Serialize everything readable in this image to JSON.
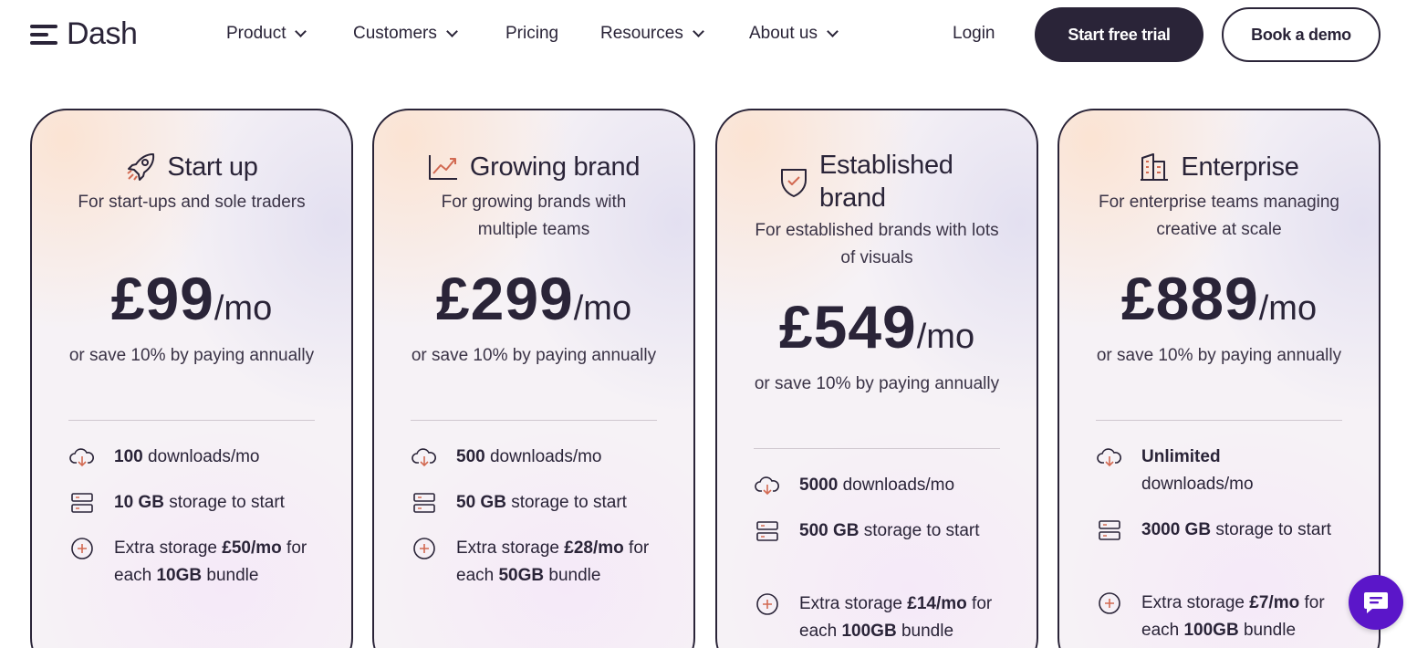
{
  "nav": {
    "logo": "Dash",
    "items": [
      {
        "label": "Product",
        "dropdown": true
      },
      {
        "label": "Customers",
        "dropdown": true
      },
      {
        "label": "Pricing",
        "dropdown": false
      },
      {
        "label": "Resources",
        "dropdown": true
      },
      {
        "label": "About us",
        "dropdown": true
      }
    ],
    "login": "Login",
    "trial": "Start free trial",
    "demo": "Book a demo"
  },
  "plans": [
    {
      "title": "Start up",
      "icon": "rocket-icon",
      "desc": "For start-ups and sole traders",
      "price": "£99",
      "per": "/mo",
      "save": "or save 10% by paying annually",
      "downloads_bold": "100",
      "downloads_rest": "downloads/mo",
      "storage_bold": "10 GB",
      "storage_rest": "storage to start",
      "extra_pre": "Extra storage",
      "extra_price": "£50/mo",
      "extra_mid": "for each",
      "extra_bundle": "10GB",
      "extra_post": "bundle"
    },
    {
      "title": "Growing brand",
      "icon": "chart-line-icon",
      "desc": "For growing brands with multiple teams",
      "price": "£299",
      "per": "/mo",
      "save": "or save 10% by paying annually",
      "downloads_bold": "500",
      "downloads_rest": "downloads/mo",
      "storage_bold": "50 GB",
      "storage_rest": "storage to start",
      "extra_pre": "Extra storage",
      "extra_price": "£28/mo",
      "extra_mid": "for each",
      "extra_bundle": "50GB",
      "extra_post": "bundle"
    },
    {
      "title": "Established brand",
      "icon": "shield-check-icon",
      "desc": "For established brands with lots of visuals",
      "price": "£549",
      "per": "/mo",
      "save": "or save 10% by paying annually",
      "downloads_bold": "5000",
      "downloads_rest": "downloads/mo",
      "storage_bold": "500 GB",
      "storage_rest": "storage to start",
      "extra_pre": "Extra storage",
      "extra_price": "£14/mo",
      "extra_mid": "for each",
      "extra_bundle": "100GB",
      "extra_post": "bundle"
    },
    {
      "title": "Enterprise",
      "icon": "building-icon",
      "desc": "For enterprise teams managing creative at scale",
      "price": "£889",
      "per": "/mo",
      "save": "or save 10% by paying annually",
      "downloads_bold": "Unlimited",
      "downloads_rest": "downloads/mo",
      "storage_bold": "3000 GB",
      "storage_rest": "storage to start",
      "extra_pre": "Extra storage",
      "extra_price": "£7/mo",
      "extra_mid": "for each",
      "extra_bundle": "100GB",
      "extra_post": "bundle"
    }
  ],
  "colors": {
    "ink": "#2a2438",
    "chat": "#5b16c9",
    "icon_accent": "#d26a52"
  }
}
